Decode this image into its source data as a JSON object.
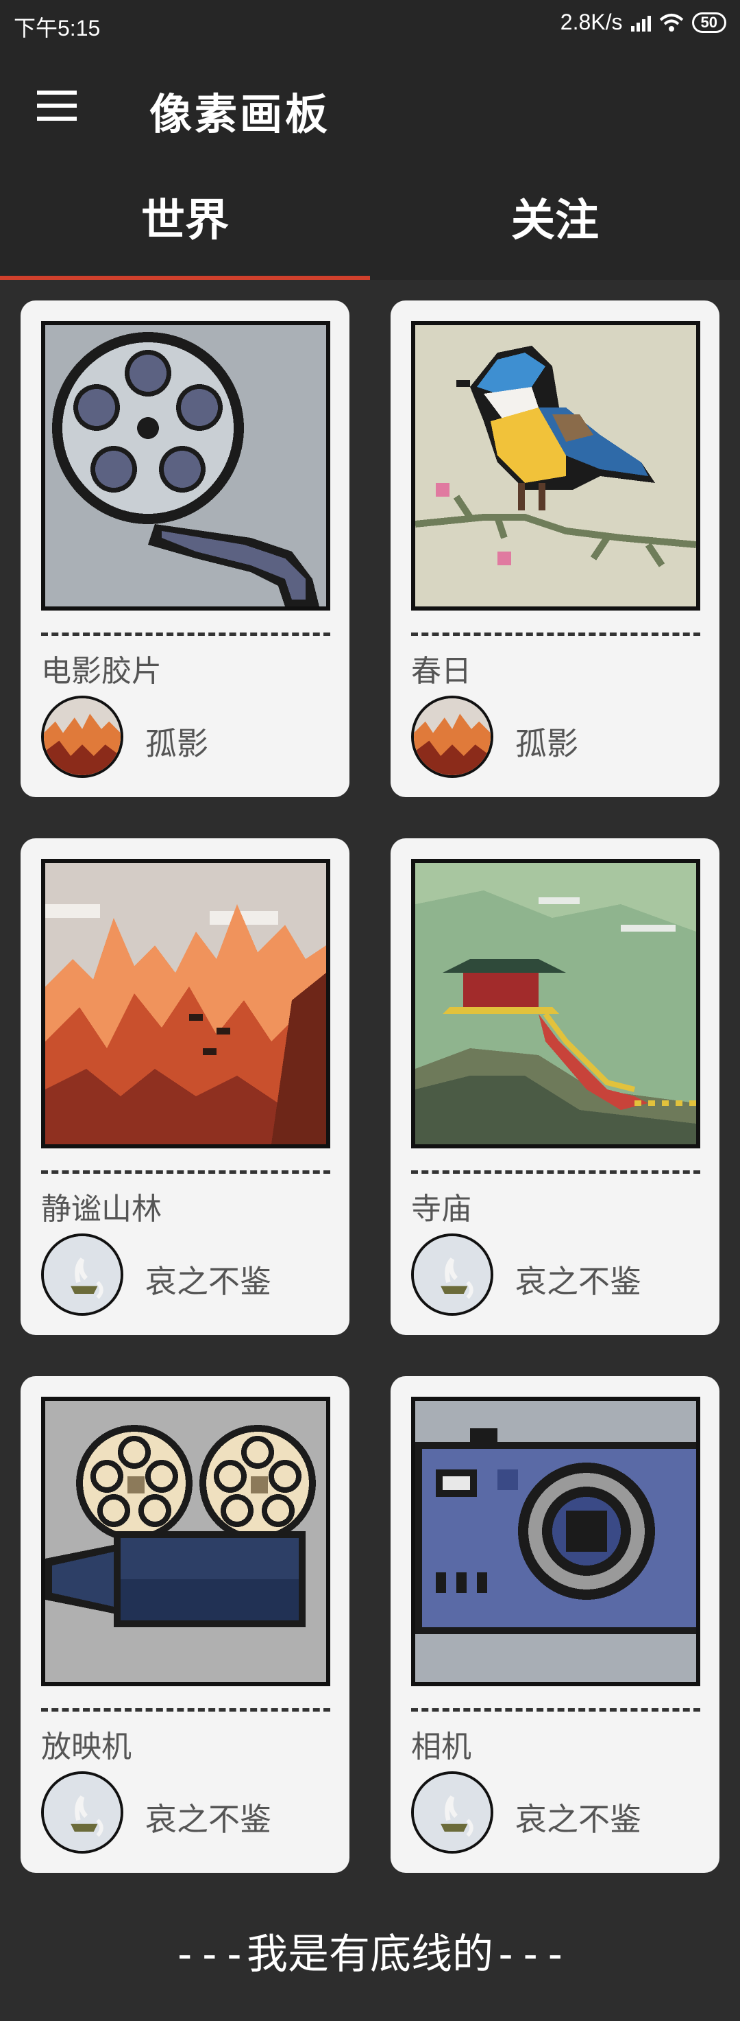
{
  "status_bar": {
    "time": "下午5:15",
    "speed": "2.8K/s",
    "battery": "50"
  },
  "app_bar": {
    "title": "像素画板"
  },
  "tabs": [
    {
      "label": "世界",
      "selected": true
    },
    {
      "label": "关注",
      "selected": false
    }
  ],
  "cards": [
    {
      "title": "电影胶片",
      "author": "孤影",
      "image": "film-reel"
    },
    {
      "title": "春日",
      "author": "孤影",
      "image": "bird-on-branch"
    },
    {
      "title": "静谧山林",
      "author": "哀之不鉴",
      "image": "orange-mountains"
    },
    {
      "title": "寺庙",
      "author": "哀之不鉴",
      "image": "hilltop-temple"
    },
    {
      "title": "放映机",
      "author": "哀之不鉴",
      "image": "film-projector"
    },
    {
      "title": "相机",
      "author": "哀之不鉴",
      "image": "camera"
    }
  ],
  "footer": "---我是有底线的---",
  "colors": {
    "background": "#2d2d2d",
    "appbar": "#262626",
    "tab_indicator": "#d0402c",
    "card": "#f4f4f4"
  }
}
